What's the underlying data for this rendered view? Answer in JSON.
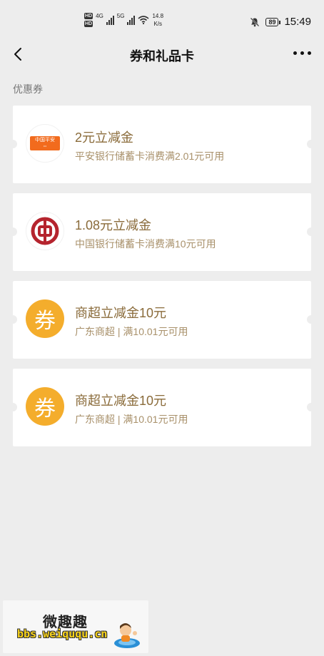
{
  "status": {
    "hd1": "HD",
    "hd2": "HD",
    "net1": "4G",
    "net2": "5G",
    "speed_value": "14.8",
    "speed_unit": "K/s",
    "battery": "89",
    "time": "15:49"
  },
  "nav": {
    "title": "券和礼品卡",
    "back_icon": "chevron-left-icon",
    "more_icon": "more-dots-icon"
  },
  "section": {
    "label": "优惠券"
  },
  "coupons": [
    {
      "title": "2元立减金",
      "subtitle": "平安银行储蓄卡消费满2.01元可用",
      "logo": "pingan-bank-logo",
      "logo_text": "中国平安"
    },
    {
      "title": "1.08元立减金",
      "subtitle": "中国银行储蓄卡消费满10元可用",
      "logo": "bank-of-china-logo"
    },
    {
      "title": "商超立减金10元",
      "subtitle": "广东商超 | 满10.01元可用",
      "logo": "coupon-icon",
      "logo_text": "券"
    },
    {
      "title": "商超立减金10元",
      "subtitle": "广东商超 | 满10.01元可用",
      "logo": "coupon-icon",
      "logo_text": "券"
    }
  ],
  "watermark": {
    "title": "微趣趣",
    "url": "bbs.weiququ.cn"
  },
  "colors": {
    "background": "#ededed",
    "card": "#ffffff",
    "coupon_title": "#8a6b3a",
    "coupon_sub": "#a8906a",
    "quan_badge": "#f4ad2c",
    "pingan_orange": "#f26b1d",
    "boc_red": "#b5242e"
  }
}
